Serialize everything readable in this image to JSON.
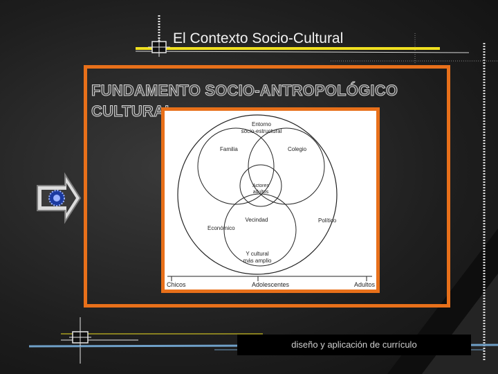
{
  "slide": {
    "title": "El Contexto Socio-Cultural",
    "heading": "FUNDAMENTO SOCIO-ANTROPOLÓGICO CULTURAL:",
    "footer": "diseño y aplicación de currículo"
  },
  "diagram": {
    "outer_label_line1": "Entorno",
    "outer_label_line2": "socio-estructural",
    "circle_family": "Familia",
    "circle_school": "Colegio",
    "center_line1": "Actores",
    "center_line2": "adultos",
    "circle_youth": "Vecindad",
    "outer_left": "Económico",
    "outer_right": "Político",
    "bottom_line1": "Y cultural",
    "bottom_line2": "más amplio",
    "axis_left": "Chicos",
    "axis_mid": "Adolescentes",
    "axis_right": "Adultos"
  },
  "colors": {
    "accent_orange": "#e8701a",
    "accent_yellow": "#f0e020",
    "line_blue": "#6fa0c8"
  },
  "icons": [
    "arrow-right-icon",
    "crosshair-icon"
  ]
}
